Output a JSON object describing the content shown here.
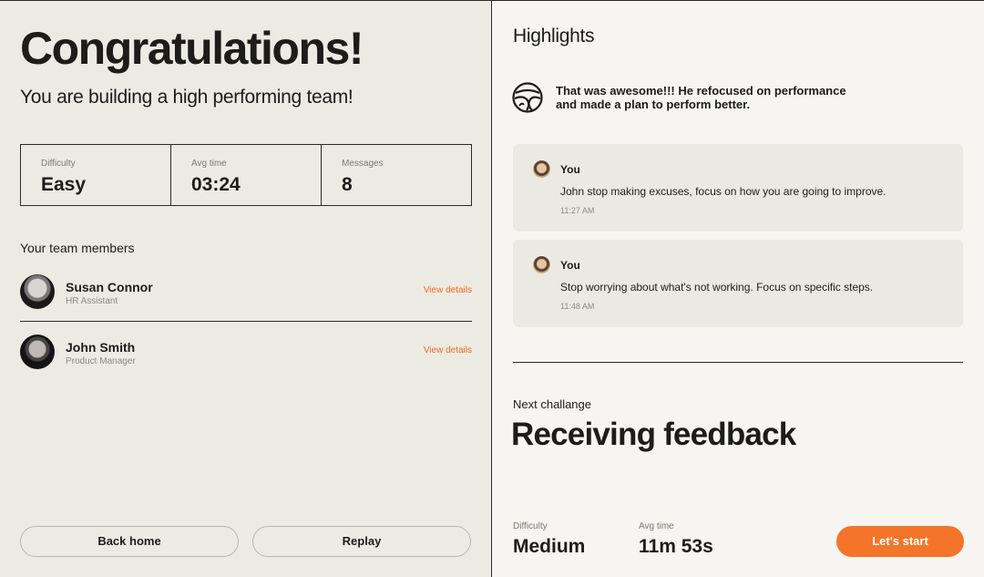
{
  "summary": {
    "title": "Congratulations!",
    "subtitle": "You are building a high performing team!",
    "stats": [
      {
        "label": "Difficulty",
        "value": "Easy"
      },
      {
        "label": "Avg time",
        "value": "03:24"
      },
      {
        "label": "Messages",
        "value": "8"
      }
    ]
  },
  "team": {
    "heading": "Your team members",
    "members": [
      {
        "name": "Susan Connor",
        "role": "HR Assistant",
        "action": "View details"
      },
      {
        "name": "John Smith",
        "role": "Product Manager",
        "action": "View details"
      }
    ]
  },
  "actions": {
    "back_label": "Back home",
    "replay_label": "Replay"
  },
  "highlights": {
    "title": "Highlights",
    "summary_text": "That was awesome!!! He refocused on performance and made a plan to perform better.",
    "messages": [
      {
        "author": "You",
        "text": "John stop making excuses, focus on how you are going to improve.",
        "time": "11:27 AM"
      },
      {
        "author": "You",
        "text": "Stop worrying about what's not working. Focus on specific steps.",
        "time": "11:48 AM"
      }
    ]
  },
  "next": {
    "label": "Next challange",
    "title": "Receiving feedback",
    "stats": [
      {
        "label": "Difficulty",
        "value": "Medium"
      },
      {
        "label": "Avg time",
        "value": "11m 53s"
      }
    ],
    "start_label": "Let's start"
  },
  "colors": {
    "accent": "#f4742a",
    "left_bg": "#ecebe3",
    "right_bg": "#f6f5f1"
  }
}
